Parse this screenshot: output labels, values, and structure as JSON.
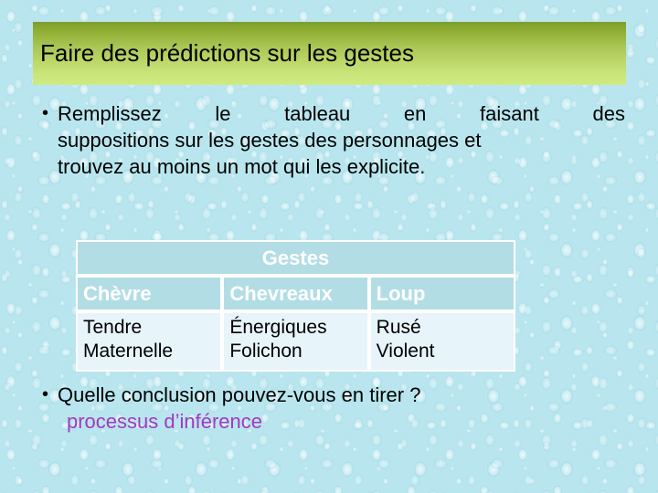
{
  "slide": {
    "title": "Faire des prédictions sur les gestes",
    "background_color": "#b9e6ee",
    "title_gradient_top": "#7c9e2b",
    "title_gradient_bottom": "#cfea81"
  },
  "bullets": [
    {
      "marker": "•",
      "lines": [
        "Remplissez le tableau en faisant des",
        "suppositions sur les gestes des personnages et",
        "trouvez au moins un mot qui les explicite."
      ]
    },
    {
      "marker": "•",
      "lines": [
        "Quelle conclusion pouvez-vous en tirer ?"
      ],
      "subtext": "processus d’inférence",
      "subtext_color": "#a23ac0"
    }
  ],
  "table": {
    "header_span": "Gestes",
    "columns": [
      "Chèvre",
      "Chevreaux",
      "Loup"
    ],
    "rows": [
      {
        "chevre": [
          "Tendre",
          "Maternelle"
        ],
        "chevreaux": [
          "Énergiques",
          "Folichon"
        ],
        "loup": [
          "Rusé",
          "Violent"
        ]
      }
    ],
    "header_fill": "#b3dde5",
    "body_fill": "#e7f4fa",
    "border_color": "#ffffff"
  }
}
